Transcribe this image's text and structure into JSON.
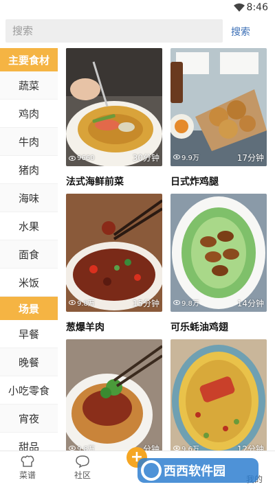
{
  "status": {
    "time": "8:46",
    "icons": [
      "wifi-icon"
    ]
  },
  "search": {
    "placeholder": "搜索",
    "button": "搜索"
  },
  "sidebar": {
    "sections": [
      {
        "title": "主要食材",
        "items": [
          "蔬菜",
          "鸡肉",
          "牛肉",
          "猪肉",
          "海味",
          "水果",
          "面食",
          "米饭"
        ]
      },
      {
        "title": "场景",
        "items": [
          "早餐",
          "晚餐",
          "小吃零食",
          "宵夜",
          "甜品"
        ]
      }
    ]
  },
  "recipes": [
    {
      "name": "法式海鲜前菜",
      "views": "9660",
      "duration": "30分钟"
    },
    {
      "name": "日式炸鸡腿",
      "views": "9.9万",
      "duration": "17分钟"
    },
    {
      "name": "葱爆羊肉",
      "views": "9.8万",
      "duration": "15分钟"
    },
    {
      "name": "可乐蚝油鸡翅",
      "views": "9.8万",
      "duration": "14分钟"
    },
    {
      "name": "",
      "views": "9.8万",
      "duration": "分钟"
    },
    {
      "name": "",
      "views": "9.6万",
      "duration": "12分钟"
    }
  ],
  "bottom_nav": {
    "recipes": "菜谱",
    "community": "社区",
    "mine": "我的"
  },
  "watermark": {
    "text": "西西软件园"
  },
  "colors": {
    "accent": "#f5b443",
    "link": "#3b6fb6",
    "fab": "#f5a623"
  }
}
